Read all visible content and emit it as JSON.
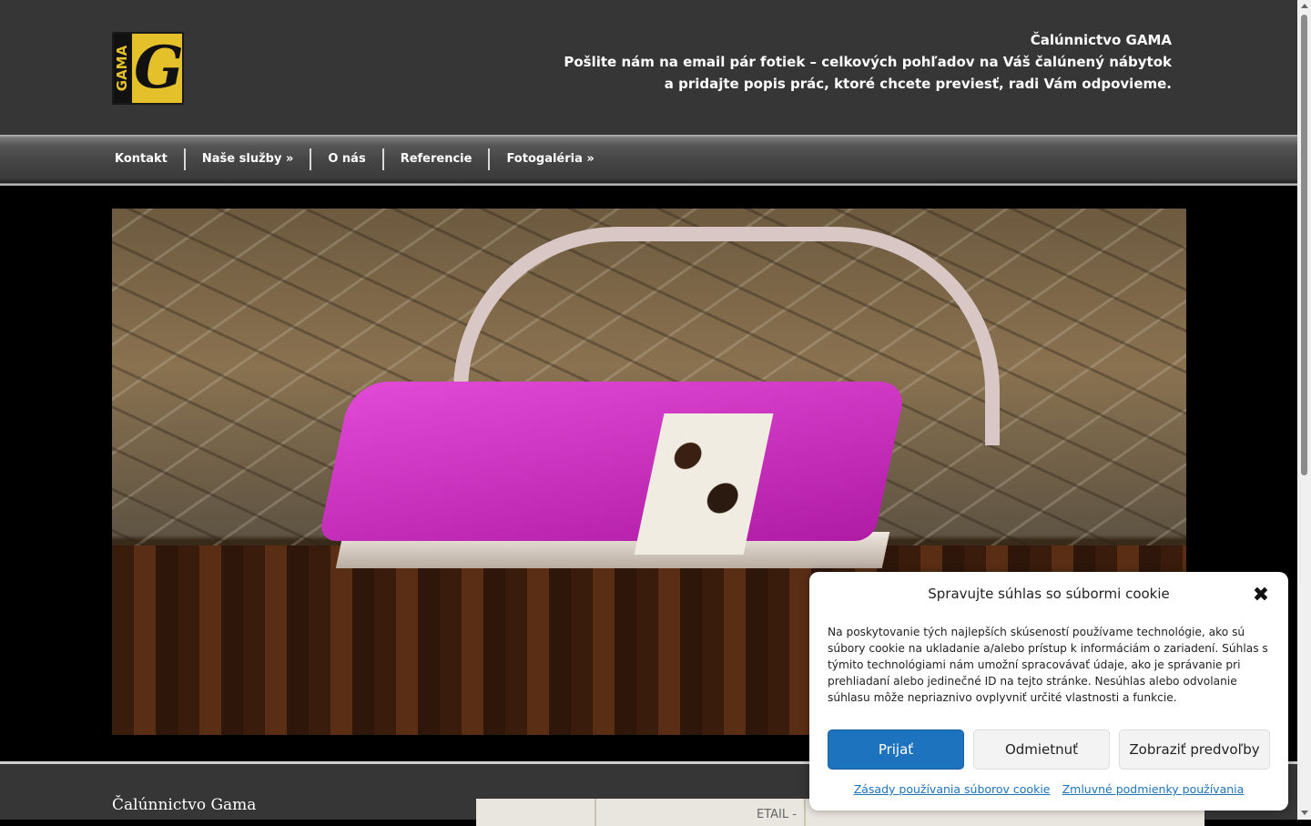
{
  "header": {
    "logo_word": "GAMA",
    "logo_letter": "G",
    "company": "Čalúnnictvo GAMA",
    "line1": "Pošlite nám na email pár fotiek – celkových pohľadov na Váš čalúnený nábytok",
    "line2": "a pridajte popis prác, ktoré chcete previesť, radi Vám odpovieme."
  },
  "nav": {
    "items": [
      {
        "label": "Kontakt"
      },
      {
        "label": "Naše služby »"
      },
      {
        "label": "O nás"
      },
      {
        "label": "Referencie"
      },
      {
        "label": "Fotogaléria »"
      }
    ]
  },
  "footer": {
    "title": "Čalúnnictvo Gama",
    "map_label": "ETAIL -"
  },
  "cookie": {
    "title": "Spravujte súhlas so súbormi cookie",
    "close": "✖",
    "text": "Na poskytovanie tých najlepších skúseností používame technológie, ako sú súbory cookie na ukladanie a/alebo prístup k informáciám o zariadení. Súhlas s týmito technológiami nám umožní spracovávať údaje, ako je správanie pri prehliadaní alebo jedinečné ID na tejto stránke. Nesúhlas alebo odvolanie súhlasu môže nepriaznivo ovplyvniť určité vlastnosti a funkcie.",
    "accept": "Prijať",
    "reject": "Odmietnuť",
    "preferences": "Zobraziť predvoľby",
    "policy_link": "Zásady používania súborov cookie",
    "terms_link": "Zmluvné podmienky používania"
  }
}
